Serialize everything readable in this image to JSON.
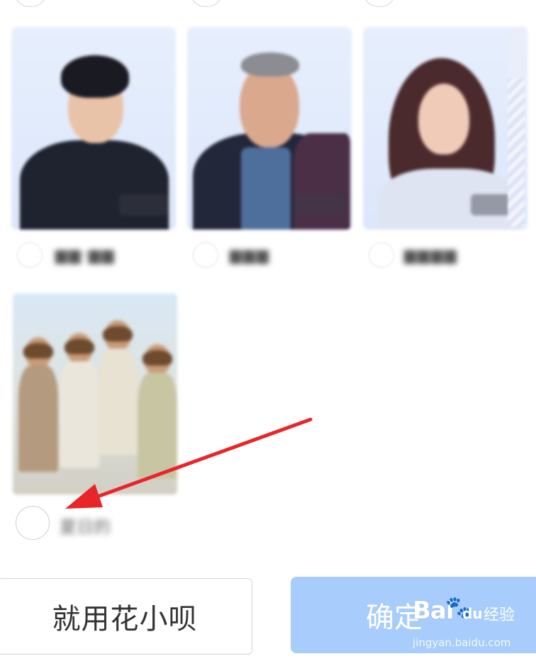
{
  "group": {
    "name": "夏日的"
  },
  "buttons": {
    "use_huaxiaobai": "就用花小呗",
    "confirm": "确定"
  },
  "watermark": {
    "logo": "Bai",
    "logo_suffix": "du",
    "jingyan": "经验",
    "url": "jingyan.baidu.com"
  },
  "colors": {
    "confirm_bg": "#a8ccfb",
    "arrow": "#e8262a"
  }
}
